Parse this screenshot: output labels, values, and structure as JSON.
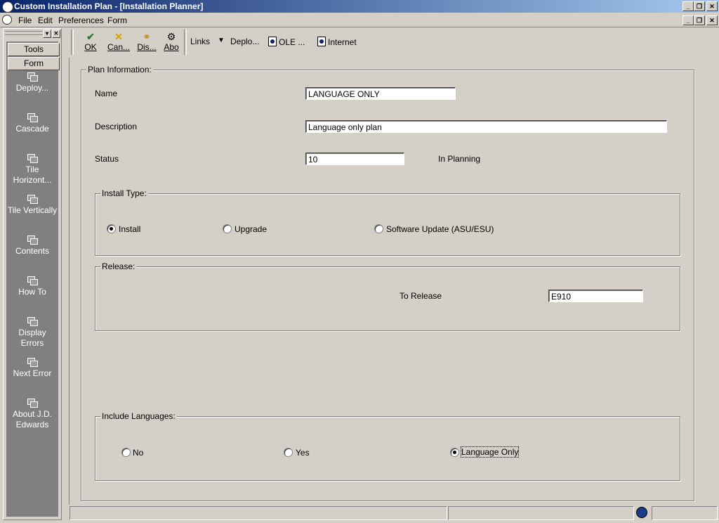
{
  "window": {
    "title": "Custom Installation Plan - [Installation Planner]"
  },
  "menubar": {
    "file": "File",
    "edit": "Edit",
    "preferences": "Preferences",
    "form": "Form"
  },
  "sidebar": {
    "tab_tools": "Tools",
    "tab_form": "Form",
    "items": [
      {
        "label": "Deploy..."
      },
      {
        "label": "Cascade"
      },
      {
        "label": "Tile Horizont..."
      },
      {
        "label": "Tile Vertically"
      },
      {
        "label": "Contents"
      },
      {
        "label": "How To"
      },
      {
        "label": "Display Errors"
      },
      {
        "label": "Next Error"
      },
      {
        "label": "About J.D. Edwards"
      }
    ]
  },
  "toolbar": {
    "ok": "OK",
    "cancel": "Can...",
    "display": "Dis...",
    "about": "Abo",
    "links": "Links",
    "deploy": "Deplo...",
    "ole": "OLE ...",
    "internet": "Internet"
  },
  "form": {
    "plan_info_legend": "Plan Information:",
    "name_label": "Name",
    "name_value": "LANGUAGE ONLY",
    "description_label": "Description",
    "description_value": "Language only plan",
    "status_label": "Status",
    "status_value": "10",
    "status_text": "In Planning",
    "install_type_legend": "Install Type:",
    "install_type_options": [
      {
        "label": "Install",
        "selected": true
      },
      {
        "label": "Upgrade",
        "selected": false
      },
      {
        "label": "Software Update (ASU/ESU)",
        "selected": false
      }
    ],
    "release_legend": "Release:",
    "to_release_label": "To Release",
    "to_release_value": "E910",
    "include_languages_legend": "Include Languages:",
    "language_options": [
      {
        "label": "No",
        "selected": false
      },
      {
        "label": "Yes",
        "selected": false
      },
      {
        "label": "Language Only",
        "selected": true
      }
    ]
  }
}
